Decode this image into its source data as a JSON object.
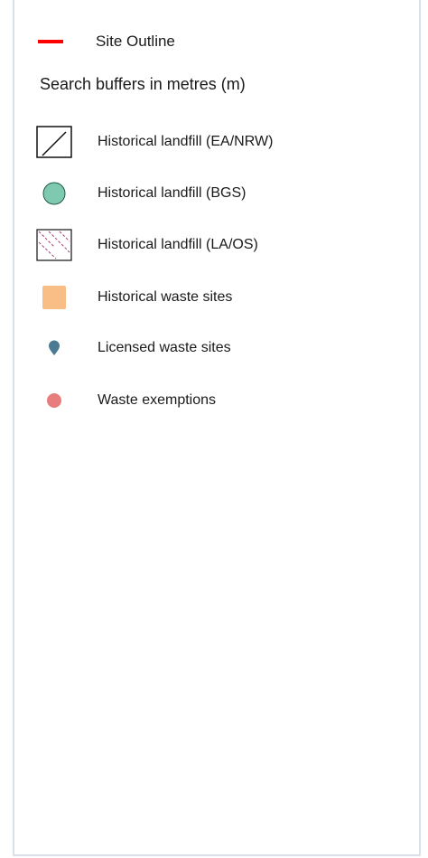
{
  "legend": {
    "site_outline": {
      "label": "Site Outline",
      "color": "#ff0000"
    },
    "heading": "Search buffers in metres (m)",
    "items": [
      {
        "label": "Historical landfill (EA/NRW)",
        "icon": "diagonal-line-square-icon"
      },
      {
        "label": "Historical landfill (BGS)",
        "icon": "circle-icon",
        "color": "#7fc9b1"
      },
      {
        "label": "Historical landfill (LA/OS)",
        "icon": "hatched-square-icon",
        "color": "#a83c7a"
      },
      {
        "label": "Historical waste sites",
        "icon": "square-icon",
        "color": "#f9bd86"
      },
      {
        "label": "Licensed waste sites",
        "icon": "map-pin-icon",
        "color": "#4b7a93"
      },
      {
        "label": "Waste exemptions",
        "icon": "dot-icon",
        "color": "#e87d7d"
      }
    ]
  }
}
